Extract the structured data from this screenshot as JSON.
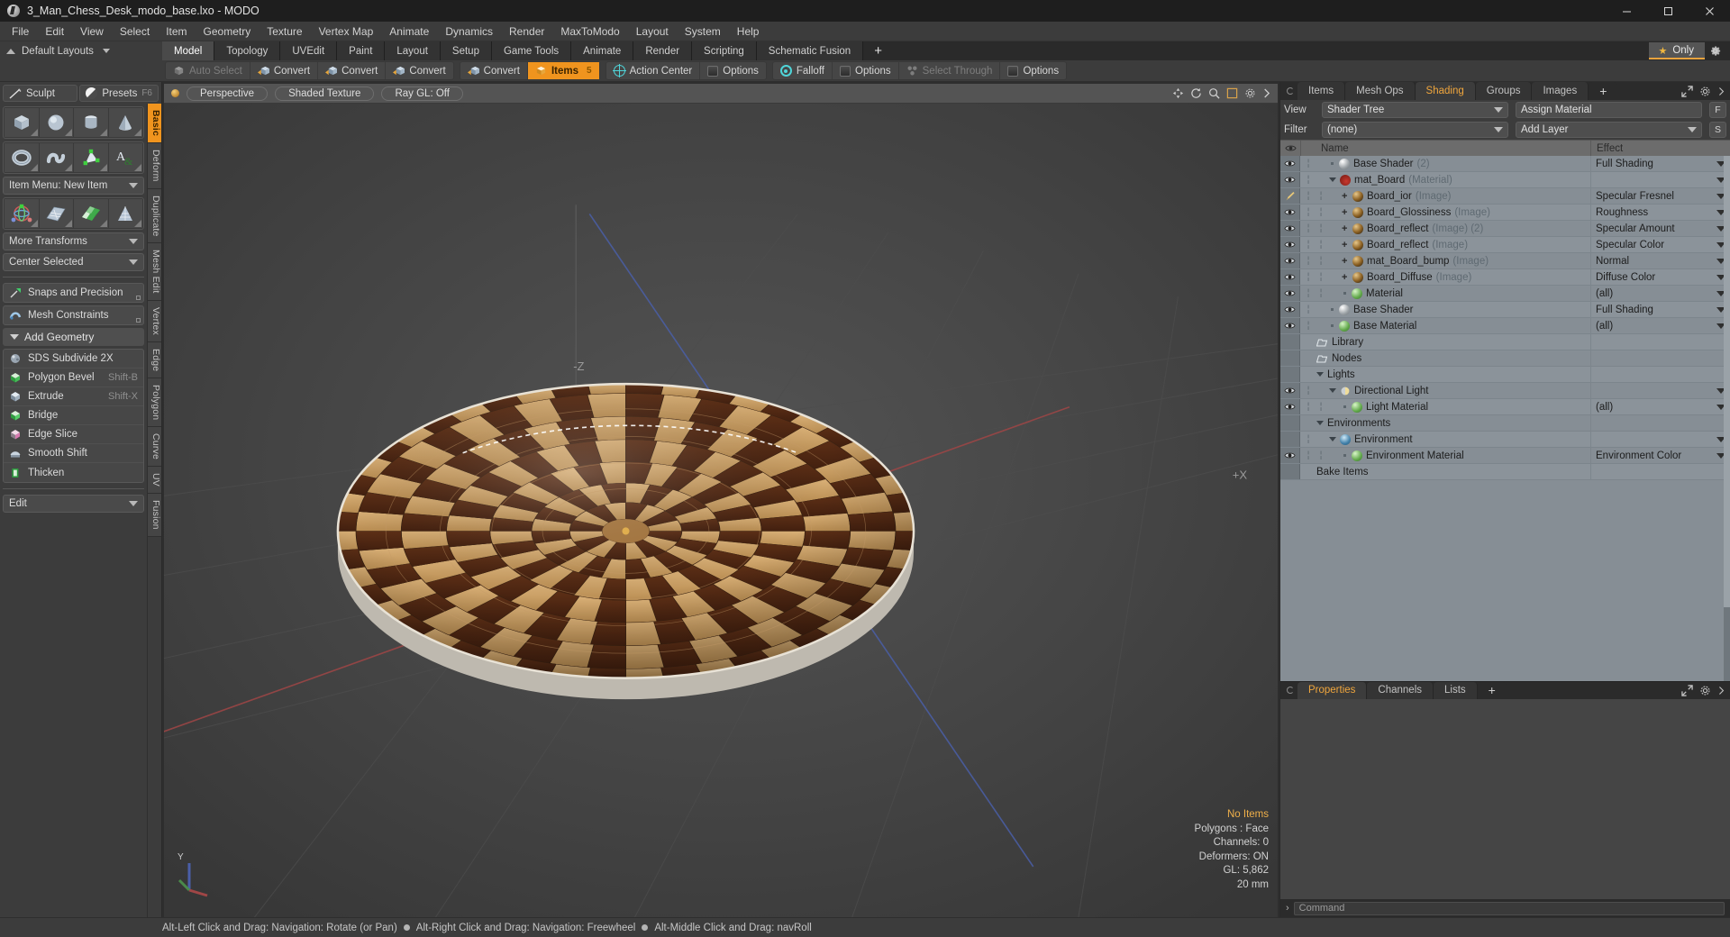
{
  "titlebar": {
    "title": "3_Man_Chess_Desk_modo_base.lxo - MODO",
    "minimize": "–",
    "maximize": "□",
    "close": "×"
  },
  "menubar": {
    "items": [
      "File",
      "Edit",
      "View",
      "Select",
      "Item",
      "Geometry",
      "Texture",
      "Vertex Map",
      "Animate",
      "Dynamics",
      "Render",
      "MaxToModo",
      "Layout",
      "System",
      "Help"
    ]
  },
  "layoutbar": {
    "preset_label": "Default Layouts",
    "tabs": [
      {
        "label": "Model",
        "active": true
      },
      {
        "label": "Topology",
        "active": false
      },
      {
        "label": "UVEdit",
        "active": false
      },
      {
        "label": "Paint",
        "active": false
      },
      {
        "label": "Layout",
        "active": false
      },
      {
        "label": "Setup",
        "active": false
      },
      {
        "label": "Game Tools",
        "active": false
      },
      {
        "label": "Animate",
        "active": false
      },
      {
        "label": "Render",
        "active": false
      },
      {
        "label": "Scripting",
        "active": false
      },
      {
        "label": "Schematic Fusion",
        "active": false
      }
    ],
    "add_tab": "+",
    "only_label": "Only",
    "only_star": "★"
  },
  "toolbar": {
    "groups": [
      {
        "buttons": [
          {
            "label": "Auto Select",
            "icon": "cube-icon",
            "state": "dim"
          },
          {
            "label": "Convert",
            "icon": "convert-vertex-icon",
            "state": "normal"
          },
          {
            "label": "Convert",
            "icon": "convert-edge-icon",
            "state": "normal"
          },
          {
            "label": "Convert",
            "icon": "convert-polygon-icon",
            "state": "normal"
          }
        ]
      },
      {
        "buttons": [
          {
            "label": "Convert",
            "icon": "convert-item-icon",
            "state": "normal"
          },
          {
            "label": "Items",
            "icon": "items-icon",
            "state": "active",
            "shortcut": "5"
          }
        ]
      },
      {
        "buttons": [
          {
            "label": "Action Center",
            "icon": "action-center-icon",
            "state": "normal"
          },
          {
            "label": "Options",
            "icon": "options-icon",
            "state": "normal"
          }
        ]
      },
      {
        "buttons": [
          {
            "label": "Falloff",
            "icon": "falloff-icon",
            "state": "normal"
          },
          {
            "label": "Options",
            "icon": "options-icon",
            "state": "normal"
          },
          {
            "label": "Select Through",
            "icon": "select-through-icon",
            "state": "dim"
          },
          {
            "label": "Options",
            "icon": "options-icon",
            "state": "normal"
          }
        ]
      }
    ]
  },
  "left_panel": {
    "top_buttons": [
      {
        "label": "Sculpt",
        "icon": "sculpt-icon",
        "shortcut": ""
      },
      {
        "label": "Presets",
        "icon": "presets-sphere-icon",
        "shortcut": "F6"
      }
    ],
    "primitives_row1": [
      "cube-icon",
      "sphere-icon",
      "cylinder-icon",
      "cone-icon"
    ],
    "primitives_row2": [
      "torus-icon",
      "tube-icon",
      "point-mesh-icon",
      "text-icon"
    ],
    "item_menu": "Item Menu: New Item",
    "transforms_row": [
      "transform-gizmo-icon",
      "grid-plane-icon",
      "checker-plane-icon",
      "cone-mesh-icon"
    ],
    "more_transforms": "More Transforms",
    "center_selected": "Center Selected",
    "snaps": "Snaps and Precision",
    "mesh_constraints": "Mesh Constraints",
    "add_geometry": "Add Geometry",
    "geometry_items": [
      {
        "label": "SDS Subdivide 2X",
        "key": "",
        "icon": "sds-icon"
      },
      {
        "label": "Polygon Bevel",
        "key": "Shift-B",
        "icon": "bevel-icon"
      },
      {
        "label": "Extrude",
        "key": "Shift-X",
        "icon": "extrude-icon"
      },
      {
        "label": "Bridge",
        "key": "",
        "icon": "bridge-icon"
      },
      {
        "label": "Edge Slice",
        "key": "",
        "icon": "edge-slice-icon"
      },
      {
        "label": "Smooth Shift",
        "key": "",
        "icon": "smooth-shift-icon"
      },
      {
        "label": "Thicken",
        "key": "",
        "icon": "thicken-icon"
      }
    ],
    "edit_dropdown": "Edit",
    "vertical_tabs": [
      {
        "label": "Basic",
        "active": true
      },
      {
        "label": "Deform",
        "active": false
      },
      {
        "label": "Duplicate",
        "active": false
      },
      {
        "label": "Mesh Edit",
        "active": false
      },
      {
        "label": "Vertex",
        "active": false
      },
      {
        "label": "Edge",
        "active": false
      },
      {
        "label": "Polygon",
        "active": false
      },
      {
        "label": "Curve",
        "active": false
      },
      {
        "label": "UV",
        "active": false
      },
      {
        "label": "Fusion",
        "active": false
      }
    ]
  },
  "viewport": {
    "mode_buttons": [
      "Perspective",
      "Shaded Texture",
      "Ray GL: Off"
    ],
    "corner_label": "+X",
    "axis_label": "Y",
    "stats": [
      {
        "text": "No Items",
        "highlight": true
      },
      {
        "text": "Polygons : Face",
        "highlight": false
      },
      {
        "text": "Channels: 0",
        "highlight": false
      },
      {
        "text": "Deformers: ON",
        "highlight": false
      },
      {
        "text": "GL: 5,862",
        "highlight": false
      },
      {
        "text": "20 mm",
        "highlight": false
      }
    ]
  },
  "right_panel": {
    "tabs": [
      {
        "label": "Items",
        "active": false
      },
      {
        "label": "Mesh Ops",
        "active": false
      },
      {
        "label": "Shading",
        "active": true
      },
      {
        "label": "Groups",
        "active": false
      },
      {
        "label": "Images",
        "active": false
      }
    ],
    "add_tab": "+",
    "view_label": "View",
    "view_value": "Shader Tree",
    "assign_material": "Assign Material",
    "assign_btn": "F",
    "filter_label": "Filter",
    "filter_value": "(none)",
    "add_layer": "Add Layer",
    "add_layer_btn": "S",
    "columns": {
      "name": "Name",
      "effect": "Effect"
    },
    "rows": [
      {
        "indent": 2,
        "icon": "sphere-white-icon",
        "name": "Base Shader",
        "suffix": "(2)",
        "effect": "Full Shading",
        "eye": "eye",
        "expand": "dot",
        "plus": false
      },
      {
        "indent": 2,
        "icon": "sphere-red-icon",
        "name": "mat_Board",
        "suffix": "(Material)",
        "effect": "",
        "eye": "eye",
        "expand": "tri",
        "plus": false
      },
      {
        "indent": 3,
        "icon": "image-icon",
        "name": "Board_ior",
        "suffix": "(Image)",
        "effect": "Specular Fresnel",
        "eye": "brush",
        "expand": "none",
        "plus": true
      },
      {
        "indent": 3,
        "icon": "image-icon",
        "name": "Board_Glossiness",
        "suffix": "(Image)",
        "effect": "Roughness",
        "eye": "eye",
        "expand": "none",
        "plus": true
      },
      {
        "indent": 3,
        "icon": "image-icon",
        "name": "Board_reflect",
        "suffix": "(Image) (2)",
        "effect": "Specular Amount",
        "eye": "eye",
        "expand": "none",
        "plus": true
      },
      {
        "indent": 3,
        "icon": "image-icon",
        "name": "Board_reflect",
        "suffix": "(Image)",
        "effect": "Specular Color",
        "eye": "eye",
        "expand": "none",
        "plus": true
      },
      {
        "indent": 3,
        "icon": "image-icon",
        "name": "mat_Board_bump",
        "suffix": "(Image)",
        "effect": "Normal",
        "eye": "eye",
        "expand": "none",
        "plus": true
      },
      {
        "indent": 3,
        "icon": "image-icon",
        "name": "Board_Diffuse",
        "suffix": "(Image)",
        "effect": "Diffuse Color",
        "eye": "eye",
        "expand": "none",
        "plus": true
      },
      {
        "indent": 3,
        "icon": "sphere-green-icon",
        "name": "Material",
        "suffix": "",
        "effect": "(all)",
        "eye": "eye",
        "expand": "dot",
        "plus": false
      },
      {
        "indent": 2,
        "icon": "sphere-white-icon",
        "name": "Base Shader",
        "suffix": "",
        "effect": "Full Shading",
        "eye": "eye",
        "expand": "dot",
        "plus": false
      },
      {
        "indent": 2,
        "icon": "sphere-green-icon",
        "name": "Base Material",
        "suffix": "",
        "effect": "(all)",
        "eye": "eye",
        "expand": "dot",
        "plus": false
      },
      {
        "indent": 1,
        "icon": "folder-icon",
        "name": "Library",
        "suffix": "",
        "effect": "",
        "eye": "none",
        "expand": "none",
        "plus": false
      },
      {
        "indent": 1,
        "icon": "folder-icon",
        "name": "Nodes",
        "suffix": "",
        "effect": "",
        "eye": "none",
        "expand": "none",
        "plus": false
      },
      {
        "indent": 1,
        "icon": "none",
        "name": "Lights",
        "suffix": "",
        "effect": "",
        "eye": "none",
        "expand": "tri",
        "plus": false
      },
      {
        "indent": 2,
        "icon": "light-icon",
        "name": "Directional Light",
        "suffix": "",
        "effect": "",
        "eye": "eye",
        "expand": "tri",
        "plus": false
      },
      {
        "indent": 3,
        "icon": "sphere-green-icon",
        "name": "Light Material",
        "suffix": "",
        "effect": "(all)",
        "eye": "eye",
        "expand": "dot",
        "plus": false
      },
      {
        "indent": 1,
        "icon": "none",
        "name": "Environments",
        "suffix": "",
        "effect": "",
        "eye": "none",
        "expand": "tri",
        "plus": false
      },
      {
        "indent": 2,
        "icon": "env-icon",
        "name": "Environment",
        "suffix": "",
        "effect": "",
        "eye": "none",
        "expand": "tri",
        "plus": false
      },
      {
        "indent": 3,
        "icon": "sphere-green-icon",
        "name": "Environment Material",
        "suffix": "",
        "effect": "Environment Color",
        "eye": "eye",
        "expand": "dot",
        "plus": false
      },
      {
        "indent": 1,
        "icon": "none",
        "name": "Bake Items",
        "suffix": "",
        "effect": "",
        "eye": "none",
        "expand": "none",
        "plus": false
      }
    ],
    "bottom_tabs": [
      {
        "label": "Properties",
        "active": true
      },
      {
        "label": "Channels",
        "active": false
      },
      {
        "label": "Lists",
        "active": false
      }
    ],
    "bottom_add_tab": "+"
  },
  "command": {
    "placeholder": "Command",
    "prompt": "›"
  },
  "statusbar": {
    "hints": [
      "Alt-Left Click and Drag: Navigation: Rotate (or Pan)",
      "Alt-Right Click and Drag: Navigation: Freewheel",
      "Alt-Middle Click and Drag: navRoll"
    ]
  },
  "colors": {
    "accent": "#f0941e",
    "tab_active_text": "#f0a63d",
    "panel_bg": "#3c3c3c",
    "tree_bg": "#868e95",
    "highlight_text": "#f0b04a"
  }
}
